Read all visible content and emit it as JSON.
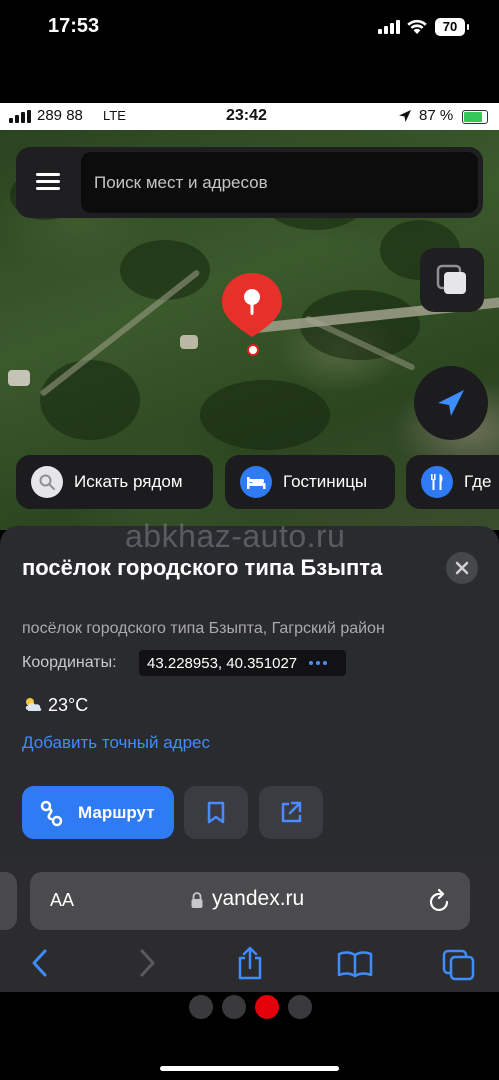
{
  "outer_status": {
    "time": "17:53",
    "battery": "70"
  },
  "inner_status": {
    "carrier": "289 88",
    "network": "LTE",
    "time": "23:42",
    "battery_pct": "87 %",
    "battery_level": 0.87
  },
  "search": {
    "placeholder": "Поиск мест и адресов"
  },
  "chips": [
    {
      "label": "Искать рядом",
      "icon": "search-icon"
    },
    {
      "label": "Гостиницы",
      "icon": "bed-icon"
    },
    {
      "label": "Где",
      "icon": "fork-knife-icon"
    }
  ],
  "watermark": "abkhaz-auto.ru",
  "place": {
    "title": "посёлок городского типа Бзыпта",
    "subtitle": "посёлок городского типа Бзыпта, Гагрский район",
    "coords_label": "Координаты:",
    "coords_value": "43.228953, 40.351027",
    "weather_temp": "23°C",
    "weather_icon": "partly-cloudy-icon",
    "add_address": "Добавить точный адрес"
  },
  "actions": {
    "route_label": "Маршрут"
  },
  "safari": {
    "aa": "AA",
    "url": "yandex.ru"
  },
  "page_dots": {
    "count": 4,
    "active_index": 2
  },
  "colors": {
    "accent_blue": "#2f7bf4",
    "pin_red": "#e8302a",
    "link_blue": "#3f8cff"
  }
}
